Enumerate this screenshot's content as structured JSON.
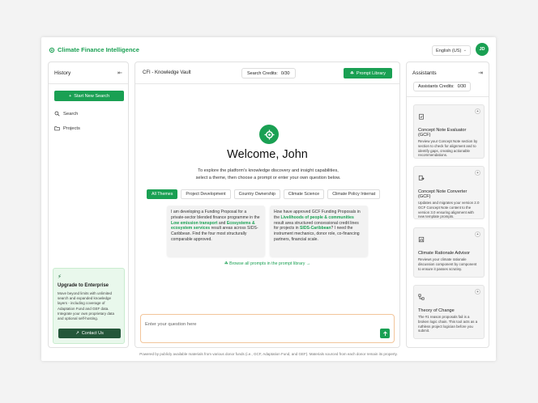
{
  "header": {
    "logo_text": "Climate Finance Intelligence",
    "language": "English (US)",
    "avatar_initials": "JD"
  },
  "history": {
    "title": "History",
    "new_search_label": "Start New Search",
    "nav": [
      {
        "label": "Search",
        "icon": "search-icon"
      },
      {
        "label": "Projects",
        "icon": "folder-icon"
      }
    ],
    "upgrade": {
      "title": "Upgrade to Enterprise",
      "text": "Move beyond limits with unlimited search and expanded knowledge layers - including coverage of Adaptation Fund and GEF data. Integrate your own proprietary data and optional self-hosting.",
      "button_label": "Contact Us"
    }
  },
  "main": {
    "title": "CFI - Knowledge Vault",
    "credits_label": "Search Credits:",
    "credits_value": "0/30",
    "prompt_library_label": "Prompt Library",
    "welcome": "Welcome, John",
    "intro_line1": "To explore the platform's knowledge discovery and insight capabilities,",
    "intro_line2": "select a theme, then choose a prompt or enter your own question below.",
    "tabs": [
      {
        "label": "All Themes",
        "active": true
      },
      {
        "label": "Project Development",
        "active": false
      },
      {
        "label": "Country Ownership",
        "active": false
      },
      {
        "label": "Climate Science",
        "active": false
      },
      {
        "label": "Climate Policy Internat",
        "active": false
      }
    ],
    "card1": {
      "p1": "I am developing a Funding Proposal for a private-sector blended finance programme in the ",
      "h1": "Low emission transport",
      "p2": " and ",
      "h2": "Ecosystems & ecosystem services",
      "p3": " result areas across SIDS-Caribbean. Find the four most structurally comparable approved."
    },
    "card2": {
      "p1": "How have approved GCF Funding Proposals in the ",
      "h1": "Livelihoods of people & communities",
      "p2": " result area structured concessional credit lines for projects in ",
      "h2": "SIDS-Caribbean",
      "p3": "? I need the instrument mechanics, donor role, co-financing partners, financial scale."
    },
    "browse_label": "Browse all prompts in the prompt library  →",
    "input_placeholder": "Enter your question here"
  },
  "assistants": {
    "title": "Assistants",
    "credits_label": "Assistants Credits:",
    "credits_value": "0/30",
    "items": [
      {
        "title": "Concept Note Evaluator (GCF)",
        "desc": "Review your Concept Note section by section to check for alignment and to identify gaps, creating actionable recommendations.",
        "icon": "clipboard-check-icon"
      },
      {
        "title": "Concept Note Converter (GCF)",
        "desc": "Updates and migrates your version 2.0 GCF Concept Note content to the version 3.0 ensuring alignment with new template prompts.",
        "icon": "document-convert-icon"
      },
      {
        "title": "Climate Rationale Advisor",
        "desc": "Reviews your climate rationale discussion component by component to ensure it passes scrutiny.",
        "icon": "chart-doc-icon"
      },
      {
        "title": "Theory of Change",
        "desc": "The #1 reason proposals fail is a broken logic chain. This tool acts as a ruthless project logician before you submit.",
        "icon": "flow-diagram-icon"
      }
    ]
  },
  "footer": {
    "text": "Powered by publicly available materials from various donor funds (i.e., GCF, Adaptation Fund, and GEF). Materials sourced from each donor remain its property."
  },
  "colors": {
    "brand_green": "#1aa053",
    "dark_green": "#24573a",
    "upgrade_bg": "#e9f8ec"
  }
}
